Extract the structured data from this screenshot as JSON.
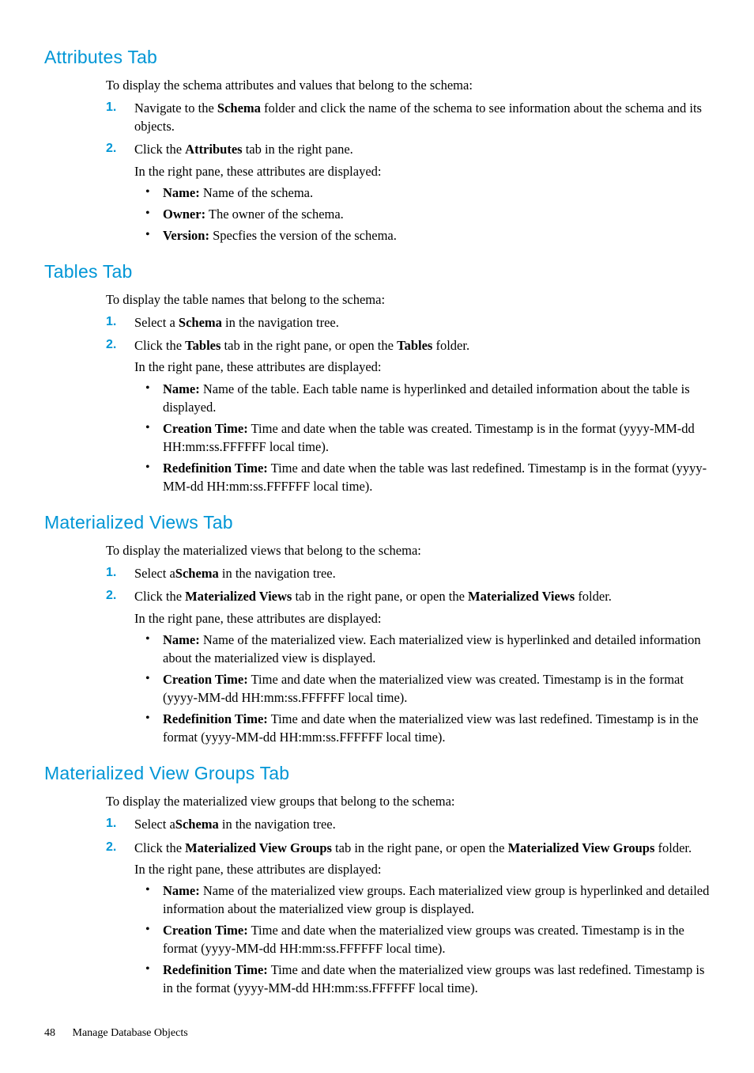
{
  "sections": [
    {
      "heading": "Attributes Tab",
      "intro": "To display the schema attributes and values that belong to the schema:",
      "steps": [
        {
          "num": "1.",
          "runs": [
            {
              "t": "Navigate to the "
            },
            {
              "t": "Schema",
              "b": true
            },
            {
              "t": " folder and click the name of the schema to see information about the schema and its objects."
            }
          ]
        },
        {
          "num": "2.",
          "runs": [
            {
              "t": "Click the "
            },
            {
              "t": "Attributes",
              "b": true
            },
            {
              "t": " tab in the right pane."
            }
          ],
          "subtext": "In the right pane, these attributes are displayed:",
          "bullets": [
            [
              {
                "t": "Name:",
                "b": true
              },
              {
                "t": " Name of the schema."
              }
            ],
            [
              {
                "t": "Owner:",
                "b": true
              },
              {
                "t": " The owner of the schema."
              }
            ],
            [
              {
                "t": "Version:",
                "b": true
              },
              {
                "t": " Specfies the version of the schema."
              }
            ]
          ]
        }
      ]
    },
    {
      "heading": "Tables Tab",
      "intro": "To display the table names that belong to the schema:",
      "steps": [
        {
          "num": "1.",
          "runs": [
            {
              "t": "Select a "
            },
            {
              "t": "Schema",
              "b": true
            },
            {
              "t": " in the navigation tree."
            }
          ]
        },
        {
          "num": "2.",
          "runs": [
            {
              "t": "Click the "
            },
            {
              "t": "Tables",
              "b": true
            },
            {
              "t": " tab in the right pane, or open the "
            },
            {
              "t": "Tables",
              "b": true
            },
            {
              "t": " folder."
            }
          ],
          "subtext": "In the right pane, these attributes are displayed:",
          "bullets": [
            [
              {
                "t": "Name:",
                "b": true
              },
              {
                "t": " Name of the table. Each table name is hyperlinked and detailed information about the table is displayed."
              }
            ],
            [
              {
                "t": "Creation Time:",
                "b": true
              },
              {
                "t": " Time and date when the table was created. Timestamp is in the format (yyyy-MM-dd HH:mm:ss.FFFFFF local time)."
              }
            ],
            [
              {
                "t": "Redefinition Time:",
                "b": true
              },
              {
                "t": " Time and date when the table was last redefined. Timestamp is in the format (yyyy-MM-dd HH:mm:ss.FFFFFF local time)."
              }
            ]
          ]
        }
      ]
    },
    {
      "heading": "Materialized Views Tab",
      "intro": "To display the materialized views that belong to the schema:",
      "steps": [
        {
          "num": "1.",
          "runs": [
            {
              "t": "Select a"
            },
            {
              "t": "Schema",
              "b": true
            },
            {
              "t": " in the navigation tree."
            }
          ]
        },
        {
          "num": "2.",
          "runs": [
            {
              "t": "Click the "
            },
            {
              "t": "Materialized Views",
              "b": true
            },
            {
              "t": " tab in the right pane, or open the "
            },
            {
              "t": "Materialized Views",
              "b": true
            },
            {
              "t": " folder."
            }
          ],
          "subtext": "In the right pane, these attributes are displayed:",
          "bullets": [
            [
              {
                "t": "Name:",
                "b": true
              },
              {
                "t": " Name of the materialized view. Each materialized view is hyperlinked and detailed information about the materialized view is displayed."
              }
            ],
            [
              {
                "t": "Creation Time:",
                "b": true
              },
              {
                "t": " Time and date when the materialized view was created. Timestamp is in the format (yyyy-MM-dd HH:mm:ss.FFFFFF local time)."
              }
            ],
            [
              {
                "t": "Redefinition Time:",
                "b": true
              },
              {
                "t": " Time and date when the materialized view was last redefined. Timestamp is in the format (yyyy-MM-dd HH:mm:ss.FFFFFF local time)."
              }
            ]
          ]
        }
      ]
    },
    {
      "heading": "Materialized View Groups Tab",
      "intro": "To display the materialized view groups that belong to the schema:",
      "steps": [
        {
          "num": "1.",
          "runs": [
            {
              "t": "Select a"
            },
            {
              "t": "Schema",
              "b": true
            },
            {
              "t": " in the navigation tree."
            }
          ]
        },
        {
          "num": "2.",
          "runs": [
            {
              "t": "Click the "
            },
            {
              "t": "Materialized View Groups",
              "b": true
            },
            {
              "t": " tab in the right pane, or open the "
            },
            {
              "t": "Materialized View Groups",
              "b": true
            },
            {
              "t": " folder."
            }
          ],
          "subtext": "In the right pane, these attributes are displayed:",
          "bullets": [
            [
              {
                "t": "Name:",
                "b": true
              },
              {
                "t": " Name of the materialized view groups. Each materialized view group is hyperlinked and detailed information about the materialized view group is displayed."
              }
            ],
            [
              {
                "t": "Creation Time:",
                "b": true
              },
              {
                "t": " Time and date when the materialized view groups was created. Timestamp is in the format (yyyy-MM-dd HH:mm:ss.FFFFFF local time)."
              }
            ],
            [
              {
                "t": "Redefinition Time:",
                "b": true
              },
              {
                "t": " Time and date when the materialized view groups was last redefined. Timestamp is in the format (yyyy-MM-dd HH:mm:ss.FFFFFF local time)."
              }
            ]
          ]
        }
      ]
    }
  ],
  "footer": {
    "page": "48",
    "chapter": "Manage Database Objects"
  }
}
